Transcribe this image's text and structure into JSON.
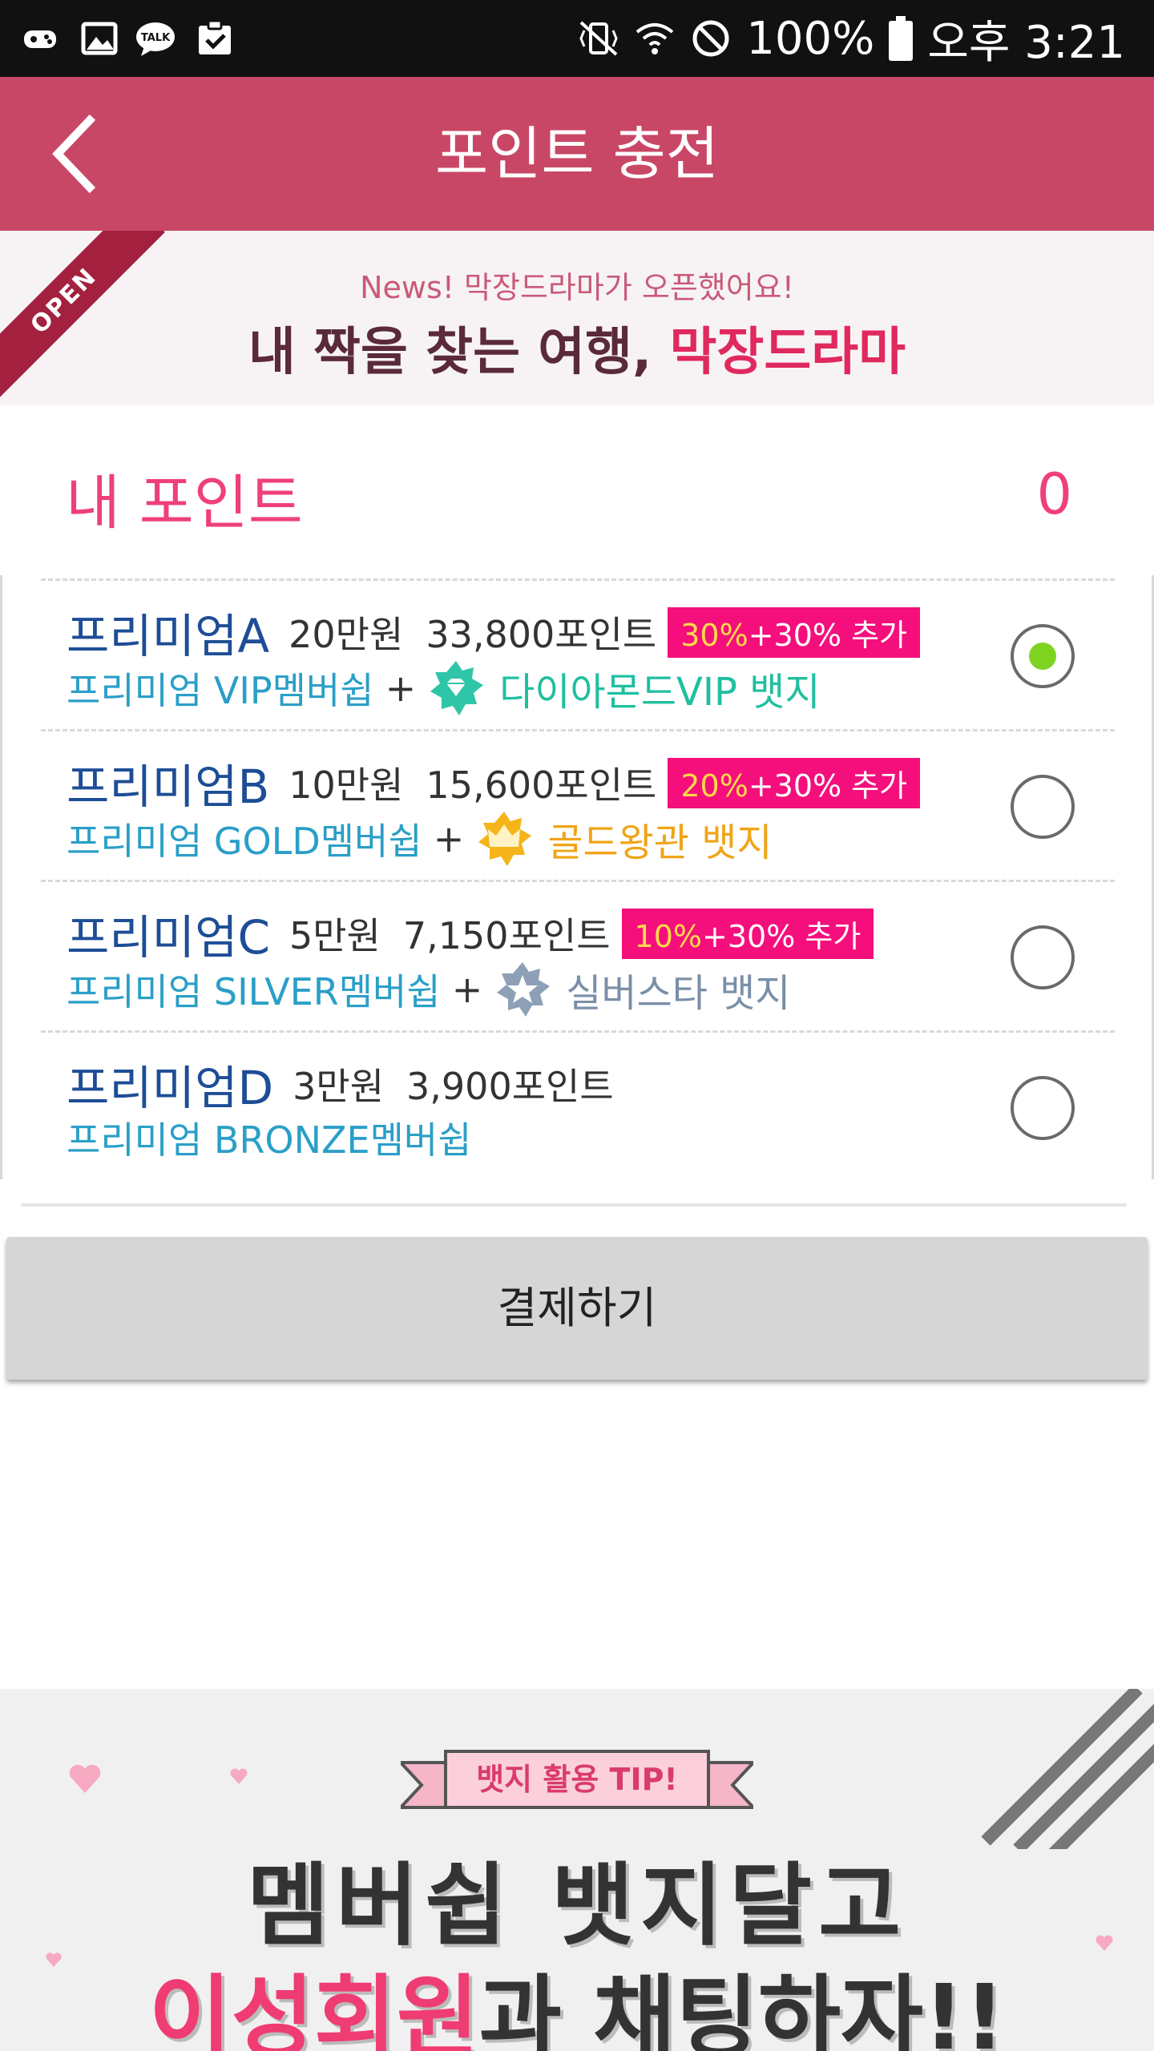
{
  "status_bar": {
    "battery": "100%",
    "time": "오후 3:21",
    "left_icons": [
      "game-controller-icon",
      "gallery-icon",
      "kakaotalk-icon",
      "clipboard-check-icon"
    ],
    "right_icons": [
      "vibrate-icon",
      "wifi-icon",
      "blocked-icon",
      "battery-icon"
    ]
  },
  "header": {
    "title": "포인트 충전",
    "back_icon": "chevron-left-icon",
    "color": "#c94766"
  },
  "news_banner": {
    "ribbon": "OPEN",
    "subtitle": "News! 막장드라마가 오픈했어요!",
    "main_prefix": "내 짝을 찾는 여행, ",
    "main_highlight": "막장드라마"
  },
  "my_points": {
    "label": "내 포인트",
    "value": "0"
  },
  "options": [
    {
      "name": "프리미엄A",
      "price": "20만원",
      "points": "33,800포인트",
      "bonus_pct": "30%",
      "bonus_rest": "+30% 추가",
      "membership": "프리미엄 VIP멤버쉽",
      "plus": "+",
      "badge": "다이아몬드VIP 뱃지",
      "badge_color": "#1fbf9f",
      "badge_icon": "diamond-icon",
      "selected": true
    },
    {
      "name": "프리미엄B",
      "price": "10만원",
      "points": "15,600포인트",
      "bonus_pct": "20%",
      "bonus_rest": "+30% 추가",
      "membership": "프리미엄 GOLD멤버쉽",
      "plus": "+",
      "badge": "골드왕관 뱃지",
      "badge_color": "#f0a416",
      "badge_icon": "crown-icon",
      "selected": false
    },
    {
      "name": "프리미엄C",
      "price": "5만원",
      "points": "7,150포인트",
      "bonus_pct": "10%",
      "bonus_rest": "+30% 추가",
      "membership": "프리미엄 SILVER멤버쉽",
      "plus": "+",
      "badge": "실버스타 뱃지",
      "badge_color": "#7a8fa8",
      "badge_icon": "star-icon",
      "selected": false
    },
    {
      "name": "프리미엄D",
      "price": "3만원",
      "points": "3,900포인트",
      "membership": "프리미엄 BRONZE멤버쉽",
      "selected": false
    }
  ],
  "pay_button": {
    "label": "결제하기"
  },
  "bottom_ad": {
    "tip": "뱃지 활용 TIP!",
    "line1": "멤버쉽 뱃지달고",
    "line2_highlight": "이성회원",
    "line2_rest": "과 채팅하자!!"
  }
}
